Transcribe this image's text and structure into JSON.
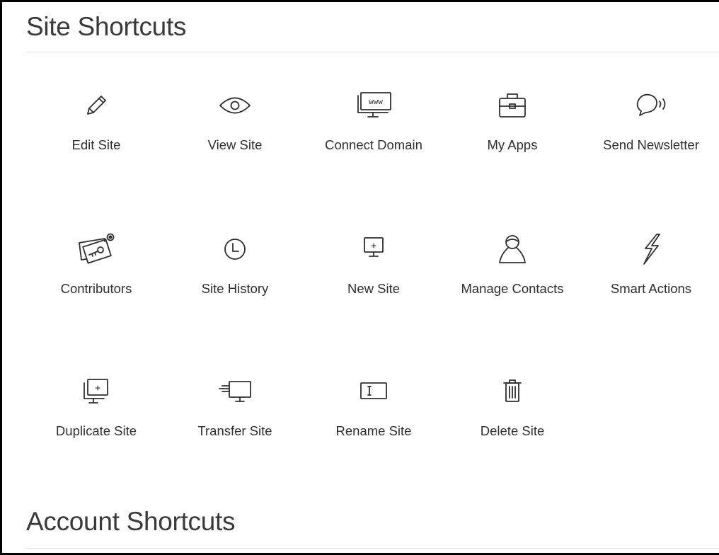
{
  "site_section": {
    "title": "Site Shortcuts",
    "shortcuts": [
      {
        "label": "Edit Site",
        "icon": "pencil-icon"
      },
      {
        "label": "View Site",
        "icon": "eye-icon"
      },
      {
        "label": "Connect Domain",
        "icon": "www-monitor-icon"
      },
      {
        "label": "My Apps",
        "icon": "briefcase-icon"
      },
      {
        "label": "Send Newsletter",
        "icon": "speech-bubble-icon"
      },
      {
        "label": "Contributors",
        "icon": "key-card-icon"
      },
      {
        "label": "Site History",
        "icon": "clock-icon"
      },
      {
        "label": "New Site",
        "icon": "monitor-plus-icon"
      },
      {
        "label": "Manage Contacts",
        "icon": "person-icon"
      },
      {
        "label": "Smart Actions",
        "icon": "lightning-icon"
      },
      {
        "label": "Duplicate Site",
        "icon": "duplicate-monitor-icon"
      },
      {
        "label": "Transfer Site",
        "icon": "transfer-monitor-icon"
      },
      {
        "label": "Rename Site",
        "icon": "text-cursor-icon"
      },
      {
        "label": "Delete Site",
        "icon": "trash-icon"
      }
    ]
  },
  "account_section": {
    "title": "Account Shortcuts"
  },
  "icon_glyphs": {
    "www": "www",
    "plus": "+"
  }
}
